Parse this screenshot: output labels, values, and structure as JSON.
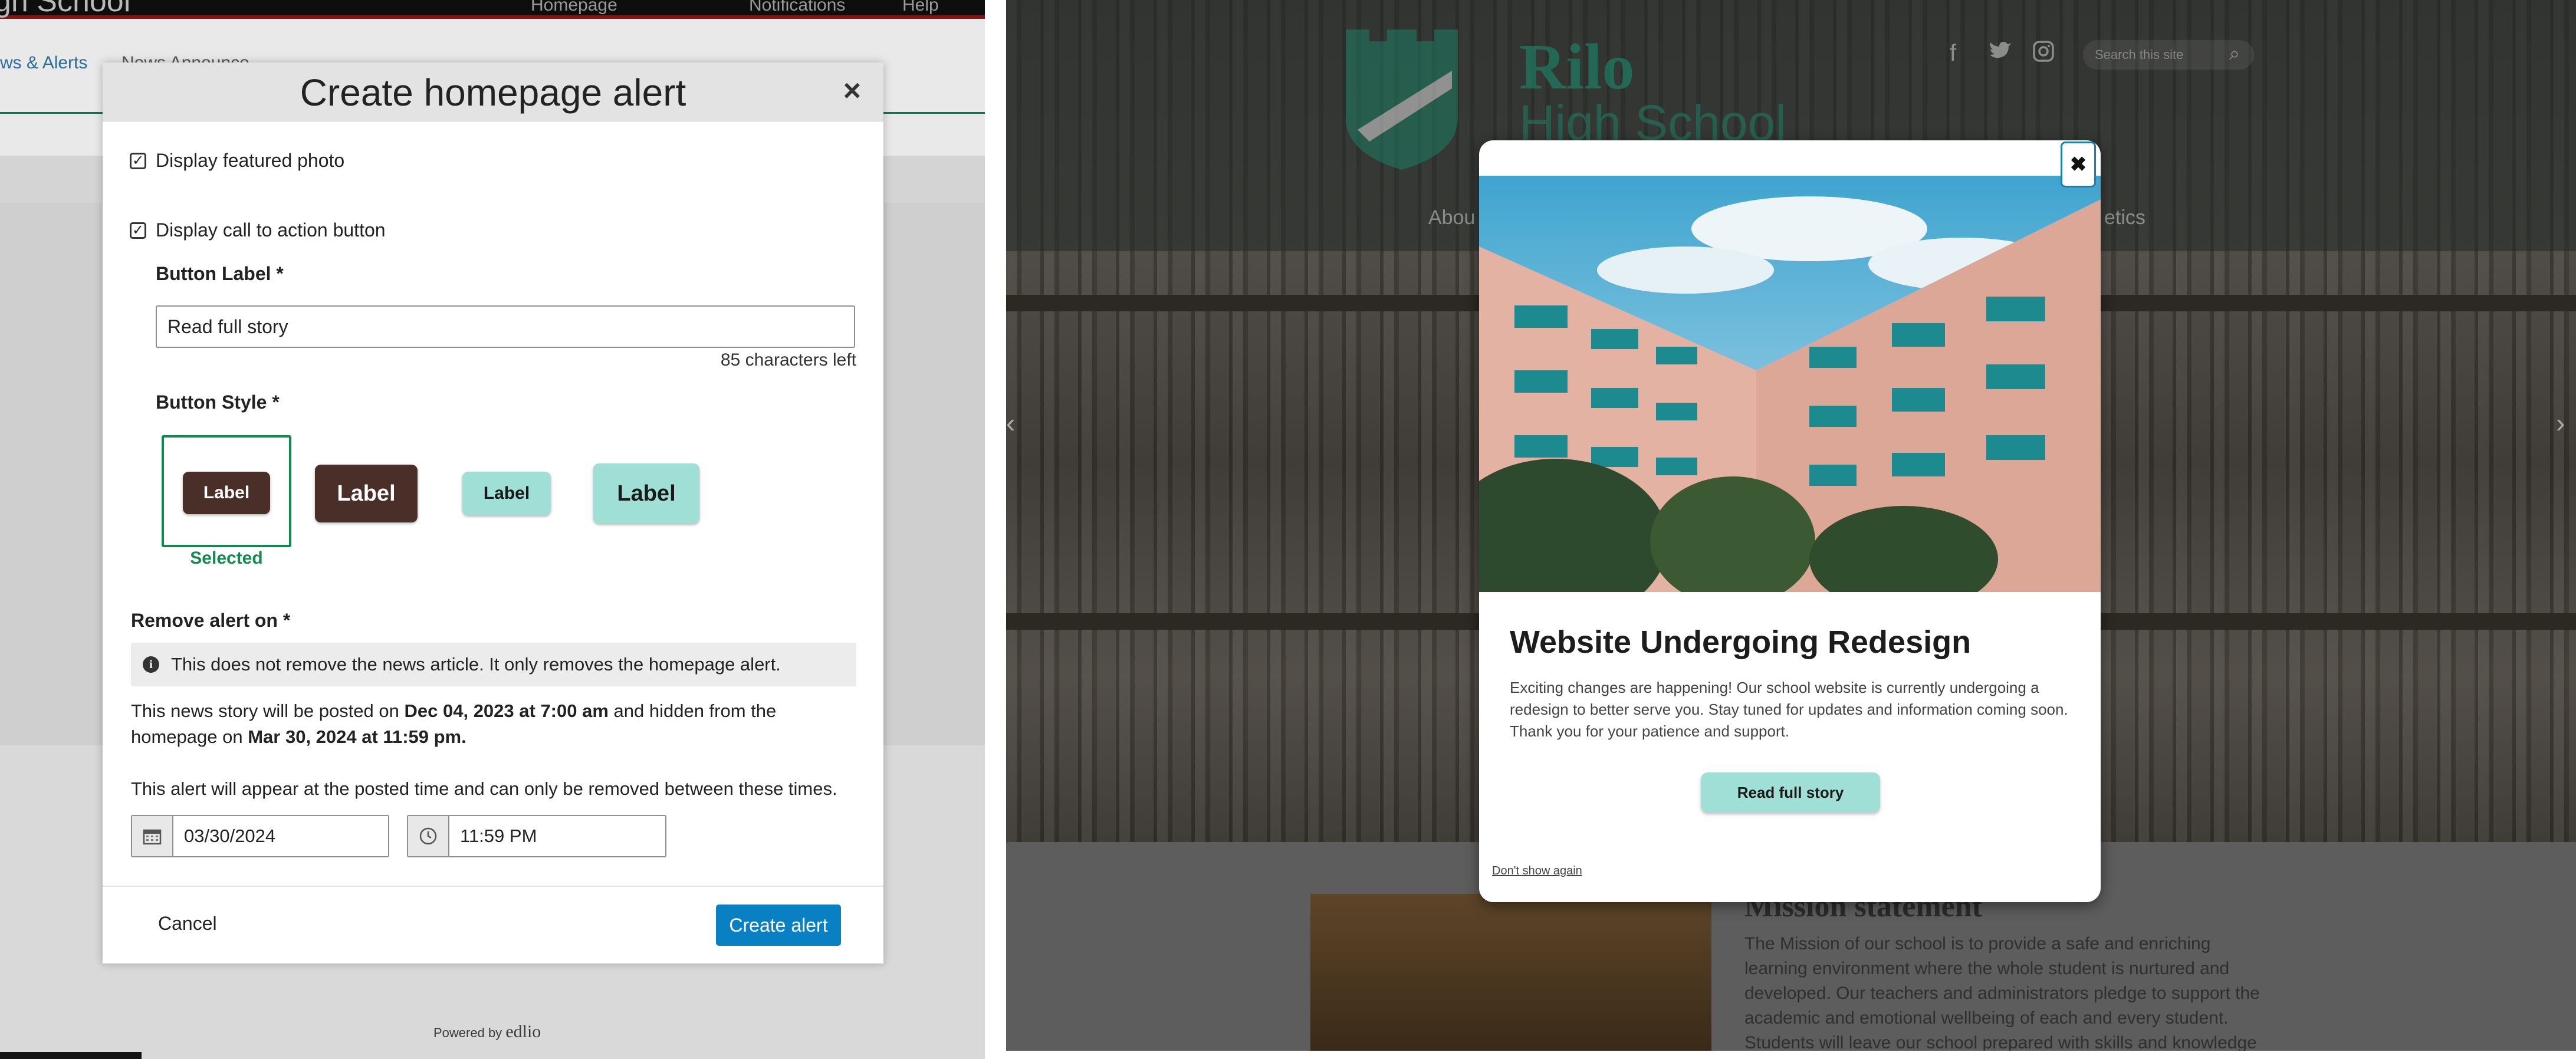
{
  "cms": {
    "bg_title": "gh School",
    "bg_nav": [
      "Homepage",
      "Notifications",
      "Help"
    ],
    "bg_crumbs": [
      "ws & Alerts",
      "News Announce..."
    ],
    "powered_by": "Powered by",
    "powered_brand": "edlio"
  },
  "modal": {
    "title": "Create homepage alert",
    "close": "×",
    "featured_photo_label": "Display featured photo",
    "cta_label": "Display call to action button",
    "button_label_field": "Button Label *",
    "button_label_value": "Read full story",
    "chars_left": "85 characters left",
    "button_style_label": "Button Style *",
    "style_options": [
      {
        "label": "Label",
        "bg": "#4a2e28",
        "fg": "#ffffff"
      },
      {
        "label": "Label",
        "bg": "#4a2e28",
        "fg": "#ffffff"
      },
      {
        "label": "Label",
        "bg": "#9fdfd6",
        "fg": "#1a1a1a"
      },
      {
        "label": "Label",
        "bg": "#9fdfd6",
        "fg": "#1a1a1a"
      }
    ],
    "selected_text": "Selected",
    "remove_label": "Remove alert on *",
    "info_text": "This does not remove the news article. It only removes the homepage alert.",
    "posted_prefix": "This news story will be posted on ",
    "posted_date": "Dec 04, 2023 at 7:00 am",
    "posted_mid": " and hidden from the homepage on ",
    "hidden_date": "Mar 30, 2024 at 11:59 pm.",
    "appear_text": "This alert will appear at the posted time and can only be removed between these times.",
    "date_value": "03/30/2024",
    "time_value": "11:59 PM",
    "cancel_label": "Cancel",
    "create_label": "Create alert",
    "accent_green": "#148a4f",
    "primary_blue": "#0a80c4"
  },
  "site": {
    "logo_line1": "Rilo",
    "logo_line2": "High School",
    "social_icons": [
      "facebook-icon",
      "twitter-icon",
      "instagram-icon"
    ],
    "search_placeholder": "Search this site",
    "nav_left": "Abou",
    "nav_right": "etics",
    "mission_title": "Mission statement",
    "mission_text": "The Mission of our school is to provide a safe and enriching learning environment where the whole student is nurtured and developed. Our teachers and administrators pledge to support the academic and emotional wellbeing of each and every student. Students will leave our school prepared with skills and knowledge"
  },
  "popup": {
    "close": "✖",
    "title": "Website Undergoing Redesign",
    "body": "Exciting changes are happening! Our school website is currently undergoing a redesign to better serve you. Stay tuned for updates and information coming soon. Thank you for your patience and support.",
    "cta": "Read full story",
    "dont_show": "Don't show again",
    "cta_color": "#9fdfd6"
  }
}
